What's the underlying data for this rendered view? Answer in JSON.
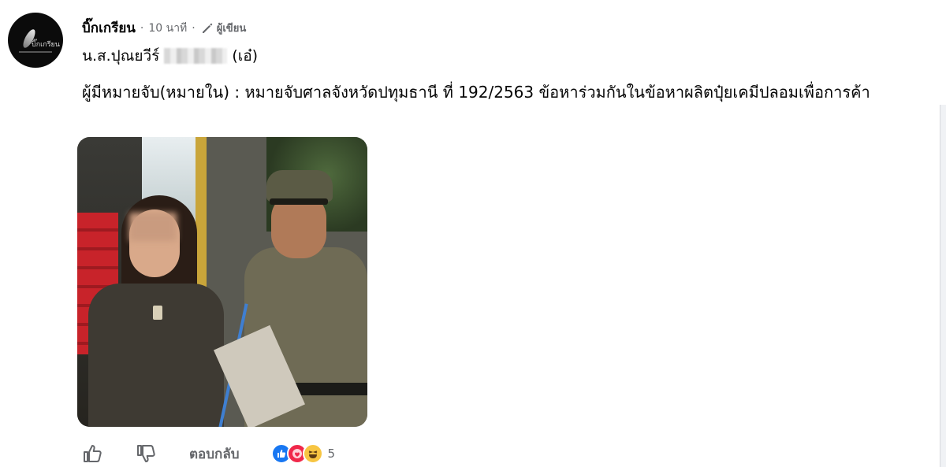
{
  "post": {
    "author": "บิ๊กเกรียน",
    "time": "10 นาที",
    "separator": "·",
    "role": "ผู้เขียน",
    "avatar_text": "บิ๊กเกรียน",
    "subject_prefix": "น.ส.ปุณยวีร์",
    "subject_suffix": "(เอ๋)",
    "body": "ผู้มีหมายจับ(หมายใน) : หมายจับศาลจังหวัดปทุมธานี ที่ 192/2563 ข้อหาร่วมกันในข้อหาผลิตปุ๋ยเคมีปลอมเพื่อการค้า"
  },
  "actions": {
    "reply_label": "ตอบกลับ",
    "reaction_count": "5",
    "reactions": [
      "like",
      "care",
      "haha"
    ]
  },
  "icons": {
    "like": "thumbs-up-icon",
    "dislike": "thumbs-down-icon",
    "role": "pencil-icon"
  },
  "colors": {
    "text": "#050505",
    "secondary": "#65676b",
    "like_blue": "#1877f2",
    "care_red": "#f0284a",
    "haha_yellow": "#f7c542"
  }
}
